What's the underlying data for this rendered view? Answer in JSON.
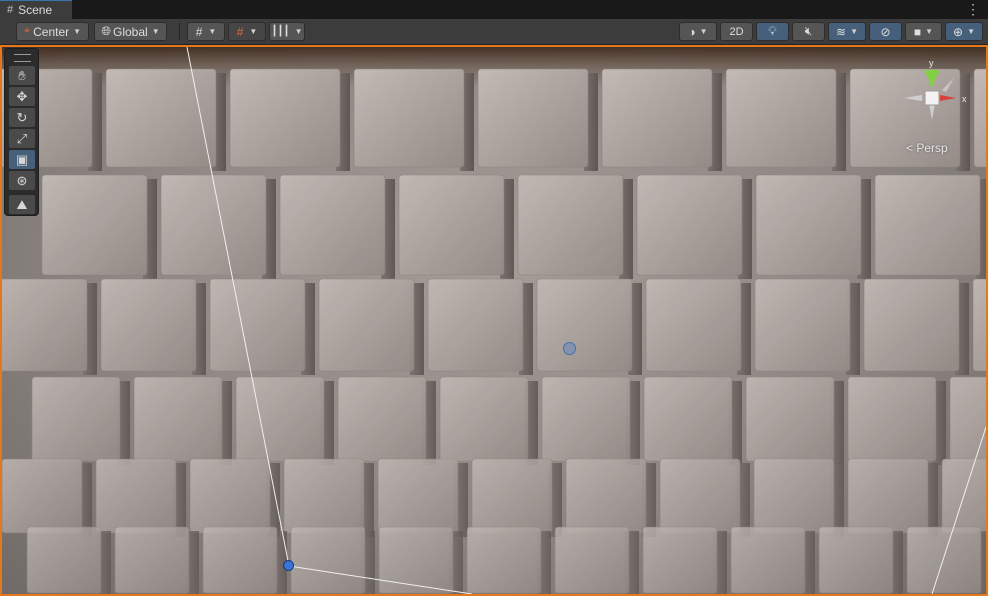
{
  "window": {
    "tab_title": "Scene",
    "tab_icon": "grid-icon",
    "menu_icon": "kebab-icon"
  },
  "toolbar": {
    "pivot_mode": "Center",
    "pivot_rotation": "Global",
    "two_d_label": "2D"
  },
  "tools": [
    "hand-tool",
    "move-tool",
    "rotate-tool",
    "scale-tool",
    "rect-tool",
    "transform-tool",
    "custom-tool"
  ],
  "selected_tool": "rect-tool",
  "gizmo": {
    "y_label": "y",
    "x_label": "x",
    "view_label": "< Persp"
  },
  "colors": {
    "selection_outline": "#e3781e",
    "accent": "#46607c",
    "gizmo_y": "#7ed43a",
    "gizmo_x": "#d8403a"
  }
}
